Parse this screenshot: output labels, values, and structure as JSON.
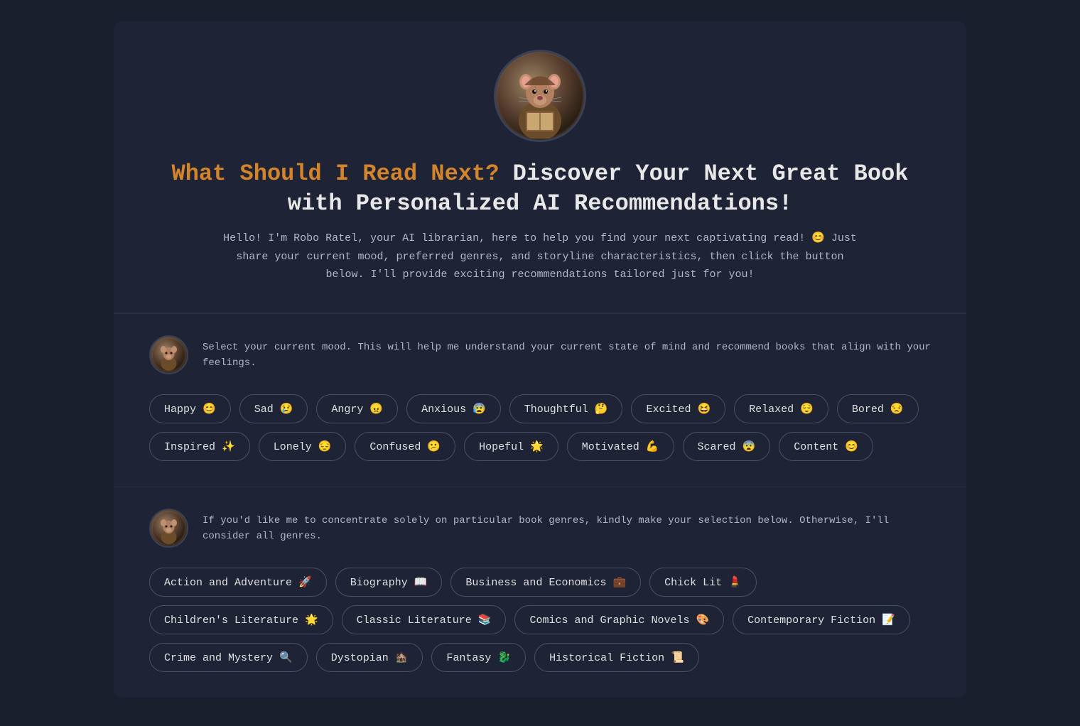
{
  "hero": {
    "avatar_emoji": "🐀",
    "title_orange": "What Should I Read Next?",
    "title_white": " Discover Your Next Great Book with Personalized AI Recommendations!",
    "subtitle": "Hello! I'm Robo Ratel, your AI librarian, here to help you find your next captivating read! 😊 Just share your current mood, preferred genres, and storyline characteristics, then click the button below. I'll provide exciting recommendations tailored just for you!"
  },
  "mood_section": {
    "avatar_emoji": "🐀",
    "description": "Select your current mood. This will help me understand your current state of mind and recommend books that align with your feelings.",
    "moods": [
      {
        "label": "Happy",
        "emoji": "😊"
      },
      {
        "label": "Sad",
        "emoji": "😢"
      },
      {
        "label": "Angry",
        "emoji": "😠"
      },
      {
        "label": "Anxious",
        "emoji": "😰"
      },
      {
        "label": "Thoughtful",
        "emoji": "🤔"
      },
      {
        "label": "Excited",
        "emoji": "😆"
      },
      {
        "label": "Relaxed",
        "emoji": "😌"
      },
      {
        "label": "Bored",
        "emoji": "😒"
      },
      {
        "label": "Inspired",
        "emoji": "✨"
      },
      {
        "label": "Lonely",
        "emoji": "😔"
      },
      {
        "label": "Confused",
        "emoji": "😕"
      },
      {
        "label": "Hopeful",
        "emoji": "🌟"
      },
      {
        "label": "Motivated",
        "emoji": "💪"
      },
      {
        "label": "Scared",
        "emoji": "😨"
      },
      {
        "label": "Content",
        "emoji": "😊"
      }
    ]
  },
  "genre_section": {
    "avatar_emoji": "🐀",
    "description": "If you'd like me to concentrate solely on particular book genres, kindly make your selection below. Otherwise, I'll consider all genres.",
    "genres": [
      {
        "label": "Action and Adventure",
        "emoji": "🚀"
      },
      {
        "label": "Biography",
        "emoji": "📖"
      },
      {
        "label": "Business and Economics",
        "emoji": "💼"
      },
      {
        "label": "Chick Lit",
        "emoji": "💄"
      },
      {
        "label": "Children's Literature",
        "emoji": "🌟"
      },
      {
        "label": "Classic Literature",
        "emoji": "📚"
      },
      {
        "label": "Comics and Graphic Novels",
        "emoji": "🎨"
      },
      {
        "label": "Contemporary Fiction",
        "emoji": "📝"
      },
      {
        "label": "Crime and Mystery",
        "emoji": "🔍"
      },
      {
        "label": "Dystopian",
        "emoji": "🏚️"
      },
      {
        "label": "Fantasy",
        "emoji": "🐉"
      },
      {
        "label": "Historical Fiction",
        "emoji": "📜"
      }
    ]
  }
}
